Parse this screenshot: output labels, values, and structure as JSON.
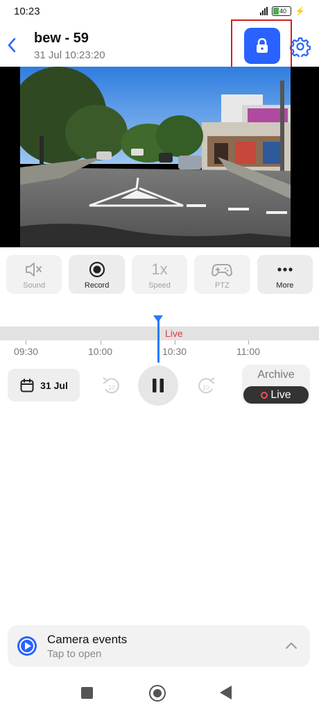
{
  "status_bar": {
    "time": "10:23",
    "battery_level": "40"
  },
  "header": {
    "title": "bew - 59",
    "subtitle": "31 Jul 10:23:20",
    "accent_color": "#2962ff"
  },
  "controls": [
    {
      "label": "Sound",
      "icon": "sound-muted-icon",
      "active": false
    },
    {
      "label": "Record",
      "icon": "record-icon",
      "active": true
    },
    {
      "label": "Speed",
      "icon": "speed-icon",
      "display": "1x",
      "active": false
    },
    {
      "label": "PTZ",
      "icon": "gamepad-icon",
      "active": false
    },
    {
      "label": "More",
      "icon": "more-icon",
      "active": true
    }
  ],
  "timeline": {
    "live_label": "Live",
    "ticks": [
      "09:30",
      "10:00",
      "10:30",
      "11:00"
    ],
    "cursor_color": "#2979ff",
    "live_color": "#e53935"
  },
  "playback": {
    "date_label": "31 Jul",
    "skip_back_seconds": "10",
    "skip_forward_seconds": "10",
    "mode_archive": "Archive",
    "mode_live": "Live"
  },
  "events": {
    "title": "Camera events",
    "subtitle": "Tap to open"
  }
}
